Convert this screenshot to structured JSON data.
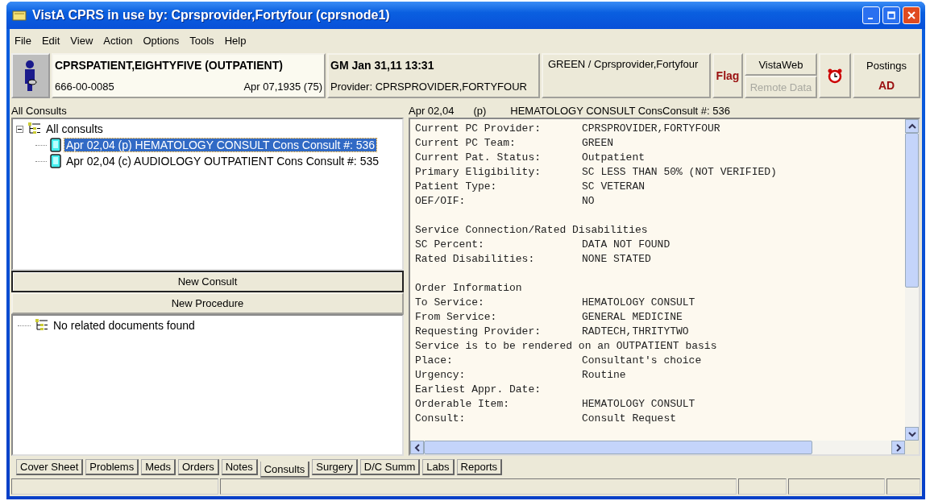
{
  "window": {
    "title": "VistA CPRS in use by: Cprsprovider,Fortyfour  (cprsnode1)"
  },
  "menu": [
    "File",
    "Edit",
    "View",
    "Action",
    "Options",
    "Tools",
    "Help"
  ],
  "patient": {
    "name": "CPRSPATIENT,EIGHTYFIVE (OUTPATIENT)",
    "ssn": "666-00-0085",
    "dob": "Apr 07,1935 (75)"
  },
  "encounter": {
    "location": "GM Jan 31,11 13:31",
    "provider": "Provider:  CPRSPROVIDER,FORTYFOUR"
  },
  "team": "GREEN / Cprsprovider,Fortyfour",
  "flag": "Flag",
  "vistaweb": {
    "label": "VistaWeb",
    "remote": "Remote Data",
    "remote_disabled": true
  },
  "postings": {
    "label": "Postings",
    "code": "AD"
  },
  "left": {
    "title": "All Consults",
    "tree": {
      "label": "All consults",
      "expanded": true,
      "children": [
        {
          "text": "Apr 02,04  (p) HEMATOLOGY CONSULT Cons Consult #: 536",
          "selected": true
        },
        {
          "text": "Apr 02,04  (c) AUDIOLOGY OUTPATIENT Cons Consult #: 535",
          "selected": false
        }
      ]
    },
    "buttons": [
      "New Consult",
      "New Procedure"
    ],
    "documents": "No related documents found"
  },
  "detail": {
    "date": "Apr 02,04",
    "status": "(p)",
    "title": "HEMATOLOGY CONSULT ConsConsult #: 536",
    "sections": [
      {
        "lines": [
          {
            "kind": "field",
            "label": "Current PC Provider:",
            "value": "CPRSPROVIDER,FORTYFOUR"
          },
          {
            "kind": "field",
            "label": "Current PC Team:",
            "value": "GREEN"
          },
          {
            "kind": "field",
            "label": "Current Pat. Status:",
            "value": "Outpatient"
          },
          {
            "kind": "field",
            "label": "Primary Eligibility:",
            "value": "SC LESS THAN 50% (NOT VERIFIED)"
          },
          {
            "kind": "field",
            "label": "Patient Type:",
            "value": "SC VETERAN"
          },
          {
            "kind": "field",
            "label": "OEF/OIF:",
            "value": "NO"
          }
        ]
      },
      {
        "heading": "Service Connection/Rated Disabilities",
        "lines": [
          {
            "kind": "field",
            "label": "SC Percent:",
            "value": "DATA NOT FOUND"
          },
          {
            "kind": "field",
            "label": "Rated Disabilities:",
            "value": "NONE STATED"
          }
        ]
      },
      {
        "heading": "Order Information",
        "lines": [
          {
            "kind": "field",
            "label": "To Service:",
            "value": "HEMATOLOGY CONSULT"
          },
          {
            "kind": "field",
            "label": "From Service:",
            "value": "GENERAL MEDICINE"
          },
          {
            "kind": "field",
            "label": "Requesting Provider:",
            "value": "RADTECH,THRITYTWO"
          },
          {
            "kind": "text",
            "text": "Service is to be rendered on an OUTPATIENT basis"
          },
          {
            "kind": "field",
            "label": "Place:",
            "value": "Consultant's choice"
          },
          {
            "kind": "field",
            "label": "Urgency:",
            "value": "Routine"
          },
          {
            "kind": "field",
            "label": "Earliest Appr. Date:"
          },
          {
            "kind": "field",
            "label": "Orderable Item:",
            "value": "HEMATOLOGY CONSULT"
          },
          {
            "kind": "field",
            "label": "Consult:",
            "value": "Consult Request"
          }
        ]
      }
    ]
  },
  "tabs": [
    {
      "label": "Cover Sheet",
      "selected": false
    },
    {
      "label": "Problems",
      "selected": false
    },
    {
      "label": "Meds",
      "selected": false
    },
    {
      "label": "Orders",
      "selected": false
    },
    {
      "label": "Notes",
      "selected": false
    },
    {
      "label": "Consults",
      "selected": true
    },
    {
      "label": "Surgery",
      "selected": false
    },
    {
      "label": "D/C Summ",
      "selected": false
    },
    {
      "label": "Labs",
      "selected": false
    },
    {
      "label": "Reports",
      "selected": false
    }
  ]
}
